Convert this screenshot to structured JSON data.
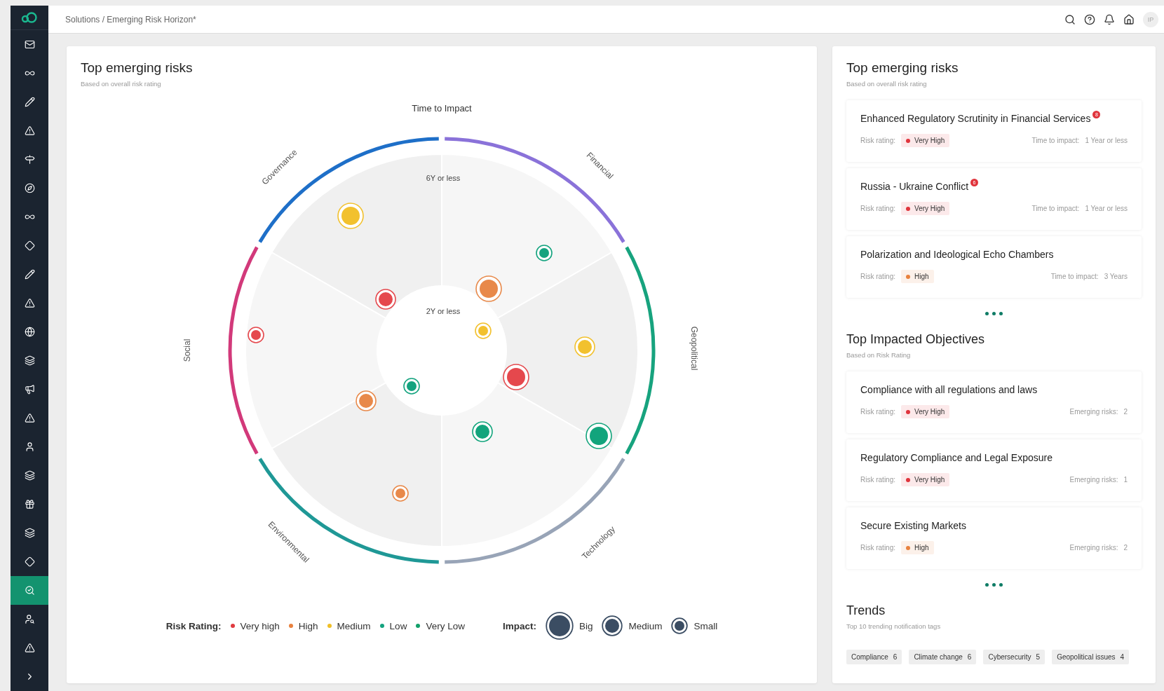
{
  "sidebar": {
    "items": [
      {
        "selected": false
      },
      {
        "selected": false
      },
      {
        "selected": false
      },
      {
        "selected": false
      },
      {
        "selected": false
      },
      {
        "selected": false
      },
      {
        "selected": false
      },
      {
        "selected": false
      },
      {
        "selected": false
      },
      {
        "selected": false
      },
      {
        "selected": false
      },
      {
        "selected": false
      },
      {
        "selected": false
      },
      {
        "selected": false
      },
      {
        "selected": false
      },
      {
        "selected": false
      },
      {
        "selected": false
      },
      {
        "selected": false
      },
      {
        "selected": false
      },
      {
        "selected": true
      },
      {
        "selected": false
      },
      {
        "selected": false
      },
      {
        "selected": false
      }
    ]
  },
  "topbar": {
    "breadcrumb": "Solutions / Emerging Risk Horizon*",
    "avatar": "IP"
  },
  "main": {
    "title": "Top emerging risks",
    "subtitle": "Based on overall risk rating",
    "radar": {
      "title": "Time to Impact",
      "rings": [
        "6Y or less",
        "2Y or less"
      ],
      "sectors": [
        {
          "label": "Financial",
          "color": "#8a72d9"
        },
        {
          "label": "Geopolitical",
          "color": "#17a37e"
        },
        {
          "label": "Technology",
          "color": "#98a4b7"
        },
        {
          "label": "Environmental",
          "color": "#1f9896"
        },
        {
          "label": "Social",
          "color": "#d2397a"
        },
        {
          "label": "Governance",
          "color": "#1e6fc8"
        }
      ]
    },
    "legend": {
      "rating_label": "Risk Rating:",
      "ratings": [
        {
          "label": "Very high",
          "color": "#e03b40"
        },
        {
          "label": "High",
          "color": "#e8813e"
        },
        {
          "label": "Medium",
          "color": "#f0bf26"
        },
        {
          "label": "Low",
          "color": "#14a37f"
        },
        {
          "label": "Very Low",
          "color": "#12a06a"
        }
      ],
      "impact_label": "Impact:",
      "impacts": [
        {
          "label": "Big",
          "kind": "big"
        },
        {
          "label": "Medium",
          "kind": "medium"
        },
        {
          "label": "Small",
          "kind": "small"
        }
      ]
    }
  },
  "side": {
    "risks": {
      "title": "Top emerging risks",
      "subtitle": "Based on overall risk rating",
      "items": [
        {
          "name": "Enhanced Regulatory Scrutinity in Financial Services",
          "badge": "8",
          "rating_label": "Risk rating:",
          "rating": "Very High",
          "color": "#e0343c",
          "time_label": "Time to impact:",
          "time": "1 Year or less"
        },
        {
          "name": "Russia - Ukraine Conflict",
          "badge": "6",
          "rating_label": "Risk rating:",
          "rating": "Very High",
          "color": "#e0343c",
          "time_label": "Time to impact:",
          "time": "1 Year or less"
        },
        {
          "name": "Polarization and Ideological Echo Chambers",
          "rating_label": "Risk rating:",
          "rating": "High",
          "color": "#e8813e",
          "time_label": "Time to impact:",
          "time": "3 Years"
        }
      ]
    },
    "objectives": {
      "title": "Top Impacted Objectives",
      "subtitle": "Based on Risk Rating",
      "items": [
        {
          "name": "Compliance with all regulations and laws",
          "rating_label": "Risk rating:",
          "rating": "Very High",
          "color": "#e0343c",
          "count_label": "Emerging risks:",
          "count": "2"
        },
        {
          "name": "Regulatory Compliance and Legal Exposure",
          "rating_label": "Risk rating:",
          "rating": "Very High",
          "color": "#e0343c",
          "count_label": "Emerging risks:",
          "count": "1"
        },
        {
          "name": "Secure Existing Markets",
          "rating_label": "Risk rating:",
          "rating": "High",
          "color": "#e8813e",
          "count_label": "Emerging risks:",
          "count": "2"
        }
      ]
    },
    "trends": {
      "title": "Trends",
      "subtitle": "Top 10 trending notification tags",
      "tags": [
        {
          "label": "Compliance",
          "count": "6"
        },
        {
          "label": "Climate change",
          "count": "6"
        },
        {
          "label": "Cybersecurity",
          "count": "5"
        },
        {
          "label": "Geopolitical issues",
          "count": "4"
        }
      ]
    }
  }
}
